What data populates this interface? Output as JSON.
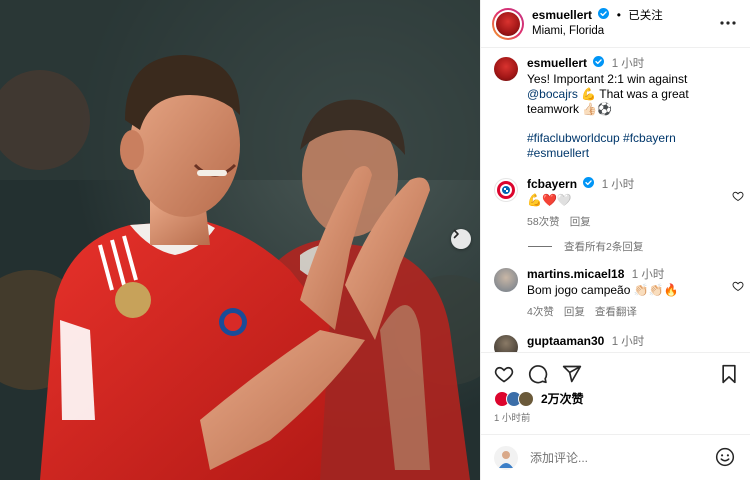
{
  "header": {
    "username": "esmuellert",
    "separator": "•",
    "follow_label": "已关注",
    "location": "Miami, Florida"
  },
  "caption": {
    "username": "esmuellert",
    "time": "1 小时",
    "text_before": "Yes! Important 2:1 win against ",
    "mention": "@bocajrs",
    "text_after": " 💪 That was a great teamwork 👍🏻⚽",
    "hashtags": "#fifaclubworldcup #fcbayern #esmuellert"
  },
  "comments": [
    {
      "username": "fcbayern",
      "time": "1 小时",
      "text": "💪❤️🤍",
      "likes": "58次赞",
      "reply_label": "回复",
      "view_replies": "查看所有2条回复"
    },
    {
      "username": "martins.micael18",
      "time": "1 小时",
      "text": "Bom jogo campeão 👏🏻👏🏻🔥",
      "likes": "4次赞",
      "reply_label": "回复",
      "translate_label": "查看翻译"
    },
    {
      "username": "guptaaman30",
      "time": "1 小时"
    }
  ],
  "footer": {
    "likes_count": "2万次赞",
    "posted_ago": "1 小时前",
    "comment_placeholder": "添加评论..."
  },
  "icons": {
    "verified": "verified-badge-icon",
    "more": "more-options-icon",
    "like": "heart-icon",
    "comment": "comment-icon",
    "share": "share-icon",
    "save": "bookmark-icon",
    "emoji": "emoji-icon",
    "next": "chevron-right-icon"
  },
  "colors": {
    "accent_link": "#00376b",
    "verified_blue": "#0095f6",
    "muted": "#737373",
    "heart_red": "#ed4956"
  }
}
